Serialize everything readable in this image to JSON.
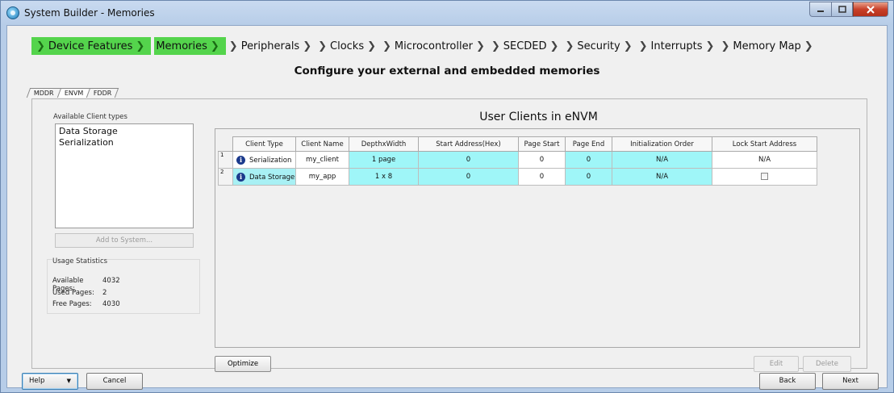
{
  "window": {
    "title": "System Builder - Memories"
  },
  "wizard": {
    "steps": [
      {
        "label": "Device Features",
        "active": true
      },
      {
        "label": "Memories",
        "active": true
      },
      {
        "label": "Peripherals",
        "active": false
      },
      {
        "label": "Clocks",
        "active": false
      },
      {
        "label": "Microcontroller",
        "active": false
      },
      {
        "label": "SECDED",
        "active": false
      },
      {
        "label": "Security",
        "active": false
      },
      {
        "label": "Interrupts",
        "active": false
      },
      {
        "label": "Memory Map",
        "active": false
      }
    ],
    "heading": "Configure your external and embedded memories"
  },
  "tabs": [
    {
      "label": "MDDR"
    },
    {
      "label": "ENVM"
    },
    {
      "label": "FDDR"
    }
  ],
  "left_pane": {
    "available_label": "Available Client types",
    "client_types": [
      "Data Storage",
      "Serialization"
    ],
    "add_button": "Add to System...",
    "usage": {
      "title": "Usage Statistics",
      "available_label": "Available Pages:",
      "available_value": "4032",
      "used_label": "Used Pages:",
      "used_value": "2",
      "free_label": "Free Pages:",
      "free_value": "4030"
    }
  },
  "right_pane": {
    "title": "User Clients in eNVM",
    "columns": [
      "Client Type",
      "Client Name",
      "DepthxWidth",
      "Start Address(Hex)",
      "Page Start",
      "Page End",
      "Initialization Order",
      "Lock Start Address"
    ],
    "rows": [
      {
        "num": "1",
        "client_type": "Serialization",
        "client_name": "my_client",
        "depth_width": "1 page",
        "start_address": "0",
        "page_start": "0",
        "page_end": "0",
        "init_order": "N/A",
        "lock_start": "N/A"
      },
      {
        "num": "2",
        "client_type": "Data Storage",
        "client_name": "my_app",
        "depth_width": "1 x 8",
        "start_address": "0",
        "page_start": "0",
        "page_end": "0",
        "init_order": "N/A",
        "lock_start": ""
      }
    ],
    "optimize_button": "Optimize",
    "edit_button": "Edit",
    "delete_button": "Delete"
  },
  "footer": {
    "help_button": "Help",
    "cancel_button": "Cancel",
    "back_button": "Back",
    "next_button": "Next"
  },
  "colors": {
    "active_step": "#54d44c",
    "cyan_cell": "#9ff6f8",
    "info_icon": "#1b3a8c"
  }
}
